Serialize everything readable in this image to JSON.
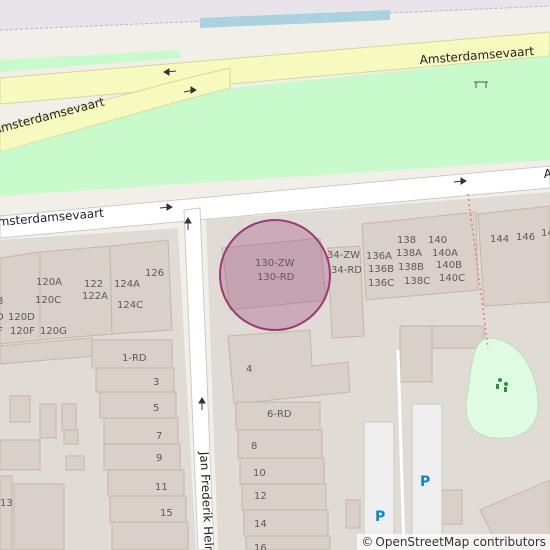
{
  "roads": {
    "top_name": "Amsterdamsevaart",
    "left_name": "Amsterdamsevaart",
    "lower_name": "msterdamsevaart",
    "lower_right_letter": "A",
    "vertical_name": "Jan Frederik Heln"
  },
  "marker": {
    "label_top": "130-ZW",
    "label_bottom": "130-RD",
    "fill": "#b38aa6",
    "stroke": "#9b3b76"
  },
  "house_numbers": {
    "n120A": "120A",
    "n122": "122",
    "n124A": "124A",
    "n126": "126",
    "n122A": "122A",
    "n120C": "120C",
    "n124C": "124C",
    "n120D": "120D",
    "n120F": "120F",
    "n120G": "120G",
    "n3": "3",
    "nD": "D",
    "nF": "F",
    "n1RD": "1-RD",
    "n3b": "3",
    "n5": "5",
    "n7": "7",
    "n9": "9",
    "n11": "11",
    "n13": "13",
    "n15": "15",
    "n34ZW": "34-ZW",
    "n34RD": "34-RD",
    "n136A": "136A",
    "n136B": "136B",
    "n136C": "136C",
    "n138": "138",
    "n138A": "138A",
    "n138B": "138B",
    "n138C": "138C",
    "n140": "140",
    "n140A": "140A",
    "n140B": "140B",
    "n140C": "140C",
    "n144": "144",
    "n146": "146",
    "n14x": "14",
    "n4": "4",
    "n6RD": "6-RD",
    "n8": "8",
    "n10": "10",
    "n12": "12",
    "n14": "14",
    "n16": "16"
  },
  "parking": {
    "p1": "P",
    "p2": "P"
  },
  "attribution": {
    "symbol": "©",
    "text": "OpenStreetMap contributors"
  },
  "colors": {
    "park": "#c8facc",
    "water": "#aad3df",
    "building": "#d9d0c9",
    "building_edge": "#c4b6ab",
    "road_yellow": "#f7fabf",
    "background": "#f2efe9",
    "marker": "#9b3b76"
  }
}
